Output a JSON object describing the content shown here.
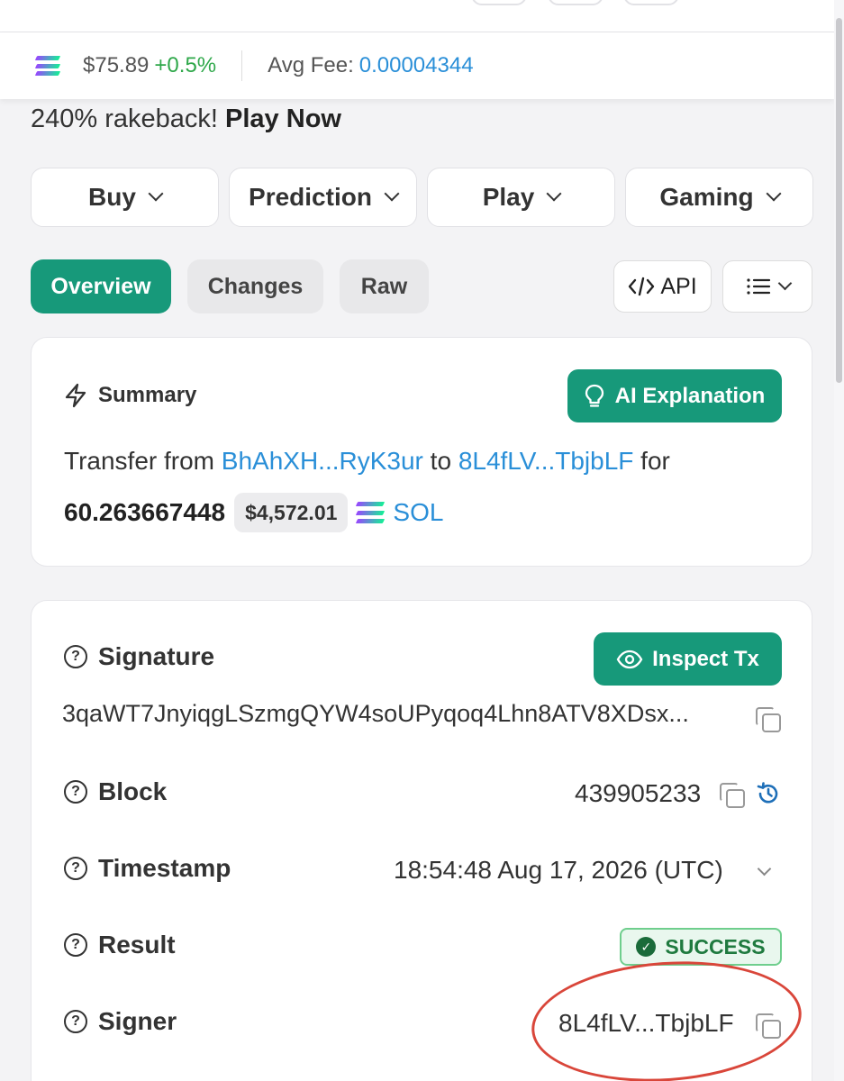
{
  "price_bar": {
    "sol_price": "$75.89",
    "sol_change": "+0.5%",
    "avg_fee_label": "Avg Fee:",
    "avg_fee_value": "0.00004344",
    "icons": {
      "sol": "solana-logo-icon"
    }
  },
  "promo": {
    "text": "240% rakeback!",
    "cta": "Play Now"
  },
  "menu": [
    {
      "label": "Buy"
    },
    {
      "label": "Prediction"
    },
    {
      "label": "Play"
    },
    {
      "label": "Gaming"
    }
  ],
  "tabs": {
    "overview": "Overview",
    "changes": "Changes",
    "raw": "Raw",
    "api": "API",
    "active": "Overview"
  },
  "summary": {
    "heading": "Summary",
    "ai_button": "AI Explanation",
    "text_prefix": "Transfer from",
    "from": "BhAhXH...RyK3ur",
    "to_word": "to",
    "to": "8L4fLV...TbjbLF",
    "for_word": "for",
    "amount": "60.263667448",
    "usd": "$4,572.01",
    "token": "SOL"
  },
  "details": {
    "signature_label": "Signature",
    "inspect_button": "Inspect Tx",
    "signature_value": "3qaWT7JnyiqgLSzmgQYW4soUPyqoq4Lhn8ATV8XDsx...",
    "block_label": "Block",
    "block_value": "439905233",
    "timestamp_label": "Timestamp",
    "timestamp_value": "18:54:48 Aug 17, 2026 (UTC)",
    "result_label": "Result",
    "result_value": "SUCCESS",
    "signer_label": "Signer",
    "signer_value": "8L4fLV...TbjbLF"
  },
  "colors": {
    "accent": "#17997a",
    "link": "#2a8fd8",
    "positive": "#2fa84a",
    "success_bg": "#e9f7ee",
    "annotation_ring": "#d9463a"
  }
}
